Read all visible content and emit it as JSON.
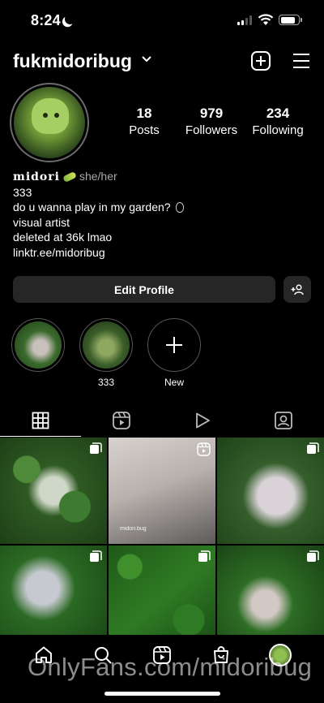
{
  "status_bar": {
    "time": "8:24",
    "battery_level": 0.85
  },
  "header": {
    "username": "fukmidoribug"
  },
  "profile": {
    "stats": [
      {
        "value": "18",
        "label": "Posts"
      },
      {
        "value": "979",
        "label": "Followers"
      },
      {
        "value": "234",
        "label": "Following"
      }
    ],
    "display_name": "midori",
    "pronouns": "she/her",
    "bio_lines": [
      "333",
      "do u wanna play in my garden?",
      "visual artist",
      "deleted at 36k lmao",
      "linktr.ee/midoribug"
    ]
  },
  "actions": {
    "edit_profile": "Edit Profile"
  },
  "highlights": [
    {
      "label": ""
    },
    {
      "label": "333"
    },
    {
      "label": "New"
    }
  ],
  "grid": {
    "post_2_caption": "midori.bug"
  },
  "watermark": "OnlyFans.com/midoribug",
  "icons": [
    "chevron-down-icon",
    "plus-square-icon",
    "menu-icon",
    "add-user-icon",
    "grid-icon",
    "reels-icon",
    "play-icon",
    "tagged-icon",
    "home-icon",
    "search-icon",
    "reels-nav-icon",
    "shop-icon"
  ]
}
